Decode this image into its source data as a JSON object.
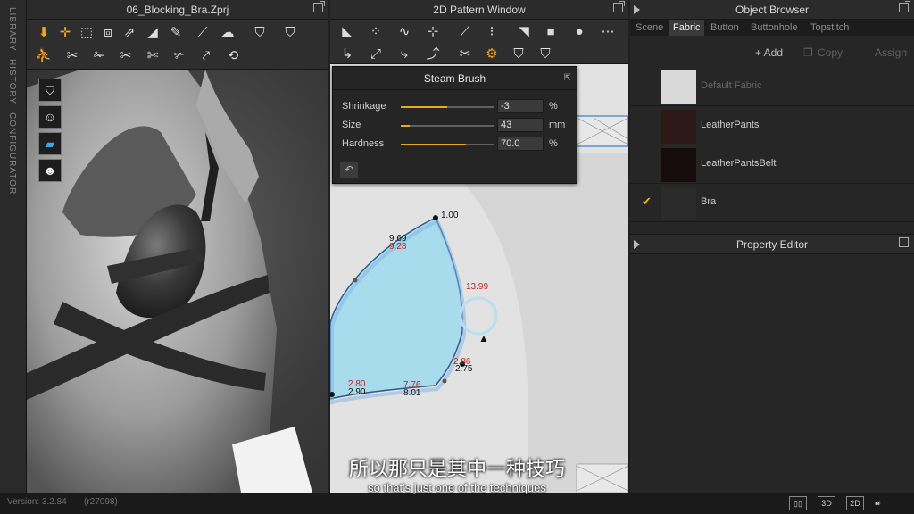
{
  "sidebar": {
    "tabs": [
      "LIBRARY",
      "HISTORY",
      "CONFIGURATOR"
    ]
  },
  "win3d": {
    "title": "06_Blocking_Bra.Zprj"
  },
  "win2d": {
    "title": "2D Pattern Window"
  },
  "steam_brush": {
    "title": "Steam Brush",
    "rows": [
      {
        "label": "Shrinkage",
        "value": "-3",
        "unit": "%",
        "level": 0.5
      },
      {
        "label": "Size",
        "value": "43",
        "unit": "mm",
        "level": 0.1
      },
      {
        "label": "Hardness",
        "value": "70.0",
        "unit": "%",
        "level": 0.7
      }
    ]
  },
  "pattern_labels": [
    "1.00",
    "9.69",
    "9.28",
    "13.99",
    "2.80",
    "2.90",
    "7.76",
    "8.01",
    "2.75",
    "2.86"
  ],
  "object_browser": {
    "title": "Object Browser",
    "tabs": [
      "Scene",
      "Fabric",
      "Button",
      "Buttonhole",
      "Topstitch"
    ],
    "active_tab": "Fabric",
    "actions": {
      "add": "+ Add",
      "copy": "Copy",
      "assign": "Assign"
    },
    "fabrics": [
      {
        "name": "Default Fabric",
        "color": "#d9d9d9",
        "selected": false
      },
      {
        "name": "LeatherPants",
        "color": "#2e1919",
        "selected": false
      },
      {
        "name": "LeatherPantsBelt",
        "color": "#160c0c",
        "selected": false
      },
      {
        "name": "Bra",
        "color": "#2b2b2b",
        "selected": true
      }
    ]
  },
  "property_editor": {
    "title": "Property Editor"
  },
  "status": {
    "version": "Version: 3.2.84",
    "build": "(r27098)",
    "view_3d": "3D",
    "view_2d": "2D"
  },
  "subtitles": {
    "cn": "所以那只是其中一种技巧",
    "en": "so that's just one of the techniques"
  }
}
